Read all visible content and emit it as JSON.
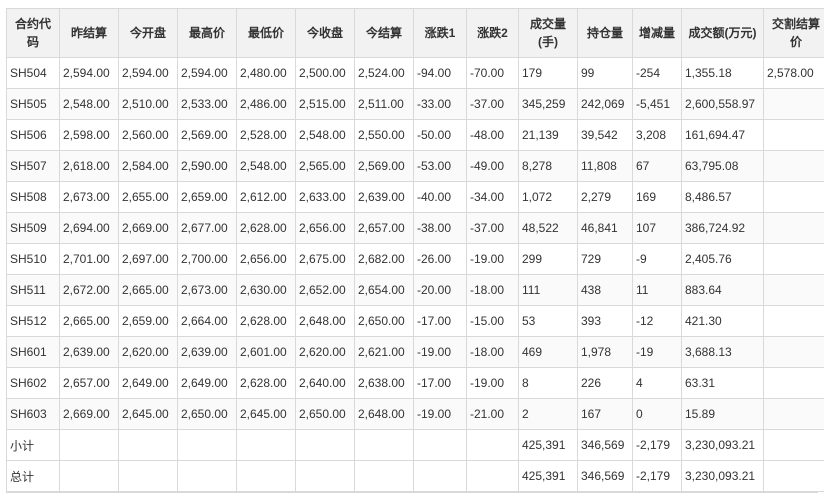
{
  "table": {
    "headers": [
      "合约代码",
      "昨结算",
      "今开盘",
      "最高价",
      "最低价",
      "今收盘",
      "今结算",
      "涨跌1",
      "涨跌2",
      "成交量(手)",
      "持仓量",
      "增减量",
      "成交额(万元)",
      "交割结算价"
    ],
    "rows": [
      [
        "SH504",
        "2,594.00",
        "2,594.00",
        "2,594.00",
        "2,480.00",
        "2,500.00",
        "2,524.00",
        "-94.00",
        "-70.00",
        "179",
        "99",
        "-254",
        "1,355.18",
        "2,578.00"
      ],
      [
        "SH505",
        "2,548.00",
        "2,510.00",
        "2,533.00",
        "2,486.00",
        "2,515.00",
        "2,511.00",
        "-33.00",
        "-37.00",
        "345,259",
        "242,069",
        "-5,451",
        "2,600,558.97",
        ""
      ],
      [
        "SH506",
        "2,598.00",
        "2,560.00",
        "2,569.00",
        "2,528.00",
        "2,548.00",
        "2,550.00",
        "-50.00",
        "-48.00",
        "21,139",
        "39,542",
        "3,208",
        "161,694.47",
        ""
      ],
      [
        "SH507",
        "2,618.00",
        "2,584.00",
        "2,590.00",
        "2,548.00",
        "2,565.00",
        "2,569.00",
        "-53.00",
        "-49.00",
        "8,278",
        "11,808",
        "67",
        "63,795.08",
        ""
      ],
      [
        "SH508",
        "2,673.00",
        "2,655.00",
        "2,659.00",
        "2,612.00",
        "2,633.00",
        "2,639.00",
        "-40.00",
        "-34.00",
        "1,072",
        "2,279",
        "169",
        "8,486.57",
        ""
      ],
      [
        "SH509",
        "2,694.00",
        "2,669.00",
        "2,677.00",
        "2,628.00",
        "2,656.00",
        "2,657.00",
        "-38.00",
        "-37.00",
        "48,522",
        "46,841",
        "107",
        "386,724.92",
        ""
      ],
      [
        "SH510",
        "2,701.00",
        "2,697.00",
        "2,700.00",
        "2,656.00",
        "2,675.00",
        "2,682.00",
        "-26.00",
        "-19.00",
        "299",
        "729",
        "-9",
        "2,405.76",
        ""
      ],
      [
        "SH511",
        "2,672.00",
        "2,665.00",
        "2,673.00",
        "2,630.00",
        "2,652.00",
        "2,654.00",
        "-20.00",
        "-18.00",
        "111",
        "438",
        "11",
        "883.64",
        ""
      ],
      [
        "SH512",
        "2,665.00",
        "2,659.00",
        "2,664.00",
        "2,628.00",
        "2,648.00",
        "2,650.00",
        "-17.00",
        "-15.00",
        "53",
        "393",
        "-12",
        "421.30",
        ""
      ],
      [
        "SH601",
        "2,639.00",
        "2,620.00",
        "2,639.00",
        "2,601.00",
        "2,620.00",
        "2,621.00",
        "-19.00",
        "-18.00",
        "469",
        "1,978",
        "-19",
        "3,688.13",
        ""
      ],
      [
        "SH602",
        "2,657.00",
        "2,649.00",
        "2,649.00",
        "2,628.00",
        "2,640.00",
        "2,638.00",
        "-17.00",
        "-19.00",
        "8",
        "226",
        "4",
        "63.31",
        ""
      ],
      [
        "SH603",
        "2,669.00",
        "2,645.00",
        "2,650.00",
        "2,645.00",
        "2,650.00",
        "2,648.00",
        "-19.00",
        "-21.00",
        "2",
        "167",
        "0",
        "15.89",
        ""
      ]
    ],
    "summary_rows": [
      [
        "小计",
        "",
        "",
        "",
        "",
        "",
        "",
        "",
        "",
        "425,391",
        "346,569",
        "-2,179",
        "3,230,093.21",
        ""
      ],
      [
        "总计",
        "",
        "",
        "",
        "",
        "",
        "",
        "",
        "",
        "425,391",
        "346,569",
        "-2,179",
        "3,230,093.21",
        ""
      ]
    ]
  }
}
